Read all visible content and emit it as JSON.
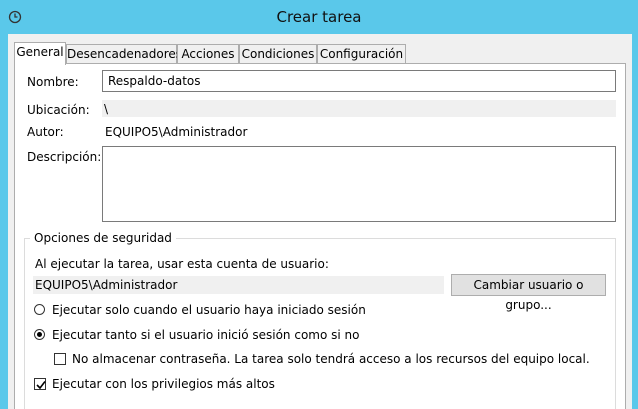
{
  "window": {
    "title": "Crear tarea",
    "icon": "clock-icon"
  },
  "tabs": [
    {
      "label": "General",
      "active": true
    },
    {
      "label": "Desencadenadores",
      "active": false
    },
    {
      "label": "Acciones",
      "active": false
    },
    {
      "label": "Condiciones",
      "active": false
    },
    {
      "label": "Configuración",
      "active": false
    }
  ],
  "general": {
    "name_label": "Nombre:",
    "name_value": "Respaldo-datos",
    "location_label": "Ubicación:",
    "location_value": "\\",
    "author_label": "Autor:",
    "author_value": "EQUIPO5\\Administrador",
    "description_label": "Descripción:",
    "description_value": ""
  },
  "security": {
    "group_title": "Opciones de seguridad",
    "run_as_label": "Al ejecutar la tarea, usar esta cuenta de usuario:",
    "run_as_value": "EQUIPO5\\Administrador",
    "change_user_button": "Cambiar usuario o grupo...",
    "option_logged_on": "Ejecutar solo cuando el usuario haya iniciado sesión",
    "option_logged_on_selected": false,
    "option_whether_logged": "Ejecutar tanto si el usuario inició sesión como si no",
    "option_whether_logged_selected": true,
    "no_store_password": "No almacenar contraseña. La tarea solo tendrá acceso a los recursos del equipo local.",
    "no_store_password_checked": false,
    "highest_privileges": "Ejecutar con los privilegios más altos",
    "highest_privileges_checked": true
  }
}
